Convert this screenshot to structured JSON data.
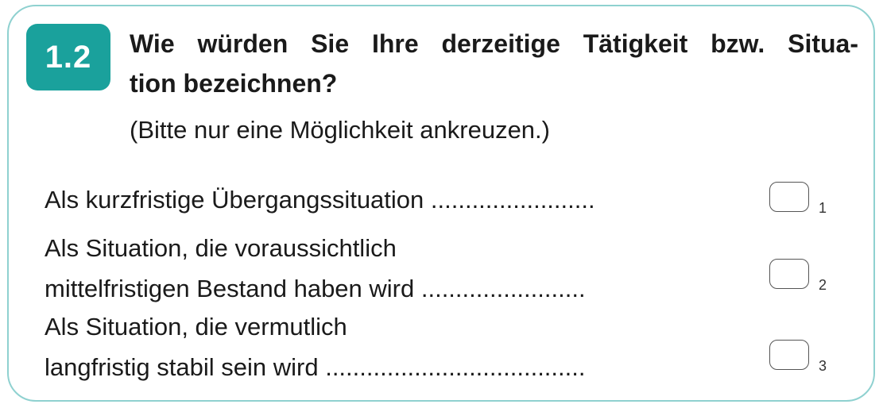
{
  "question": {
    "number": "1.2",
    "title_line1": "Wie würden Sie Ihre derzeitige Tätigkeit bzw. Situa-",
    "title_line2": "tion bezeichnen?",
    "hint": "(Bitte nur eine Möglichkeit ankreuzen.)"
  },
  "options": [
    {
      "lines": [
        "Als kurzfristige Übergangssituation ........................"
      ],
      "code": "1"
    },
    {
      "lines": [
        "Als Situation, die voraussichtlich",
        "mittelfristigen Bestand haben wird ........................"
      ],
      "code": "2"
    },
    {
      "lines": [
        "Als Situation, die vermutlich",
        "langfristig stabil sein wird ......................................"
      ],
      "code": "3"
    }
  ],
  "colors": {
    "accent": "#1aa19c",
    "border": "#8fd1d0"
  }
}
